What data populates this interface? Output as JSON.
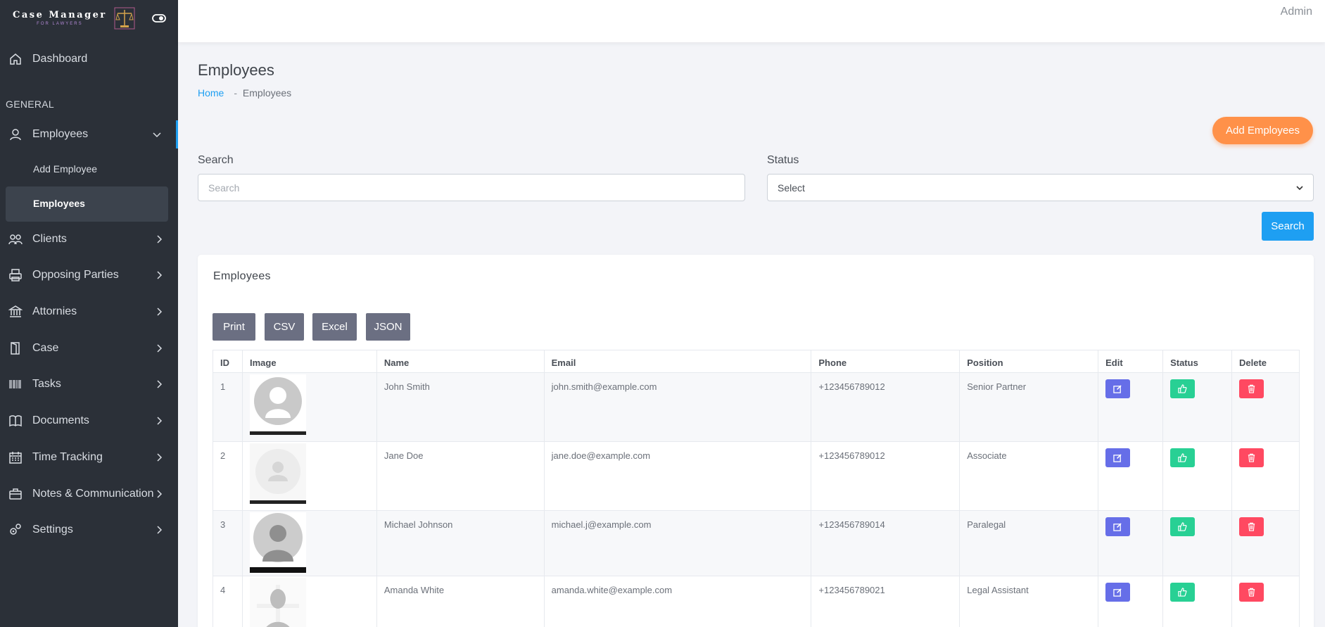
{
  "brand": {
    "title": "Case Manager",
    "subtitle": "FOR LAWYERS"
  },
  "header": {
    "user": "Admin"
  },
  "sidebar": {
    "dashboard": "Dashboard",
    "section": "GENERAL",
    "employees": "Employees",
    "sub_add": "Add Employee",
    "sub_list": "Employees",
    "items": [
      {
        "label": "Clients",
        "icon": "users-icon"
      },
      {
        "label": "Opposing Parties",
        "icon": "printer-icon"
      },
      {
        "label": "Attornies",
        "icon": "bank-icon"
      },
      {
        "label": "Case",
        "icon": "door-icon"
      },
      {
        "label": "Tasks",
        "icon": "barcode-icon"
      },
      {
        "label": "Documents",
        "icon": "book-icon"
      },
      {
        "label": "Time Tracking",
        "icon": "calendar-icon"
      },
      {
        "label": "Notes & Communication",
        "icon": "briefcase-icon"
      },
      {
        "label": "Settings",
        "icon": "gears-icon"
      }
    ]
  },
  "page": {
    "title": "Employees",
    "breadcrumb_home": "Home",
    "breadcrumb_sep": "-",
    "breadcrumb_current": "Employees",
    "add_button": "Add Employees"
  },
  "filters": {
    "search_label": "Search",
    "search_placeholder": "Search",
    "status_label": "Status",
    "status_value": "Select",
    "search_button": "Search"
  },
  "card": {
    "title": "Employees",
    "export_buttons": [
      "Print",
      "CSV",
      "Excel",
      "JSON"
    ]
  },
  "table": {
    "headers": [
      "ID",
      "Image",
      "Name",
      "Email",
      "Phone",
      "Position",
      "Edit",
      "Status",
      "Delete"
    ],
    "rows": [
      {
        "id": "1",
        "name": "John Smith",
        "email": "john.smith@example.com",
        "phone": "+123456789012",
        "position": "Senior Partner"
      },
      {
        "id": "2",
        "name": "Jane Doe",
        "email": "jane.doe@example.com",
        "phone": "+123456789012",
        "position": "Associate"
      },
      {
        "id": "3",
        "name": "Michael Johnson",
        "email": "michael.j@example.com",
        "phone": "+123456789014",
        "position": "Paralegal"
      },
      {
        "id": "4",
        "name": "Amanda White",
        "email": "amanda.white@example.com",
        "phone": "+123456789021",
        "position": "Legal Assistant"
      }
    ]
  },
  "colors": {
    "accent": "#1e9ff2",
    "add": "#ff9149",
    "edit": "#666ee8",
    "status": "#28d094",
    "delete": "#ff4961",
    "sidebar": "#2b3038"
  }
}
